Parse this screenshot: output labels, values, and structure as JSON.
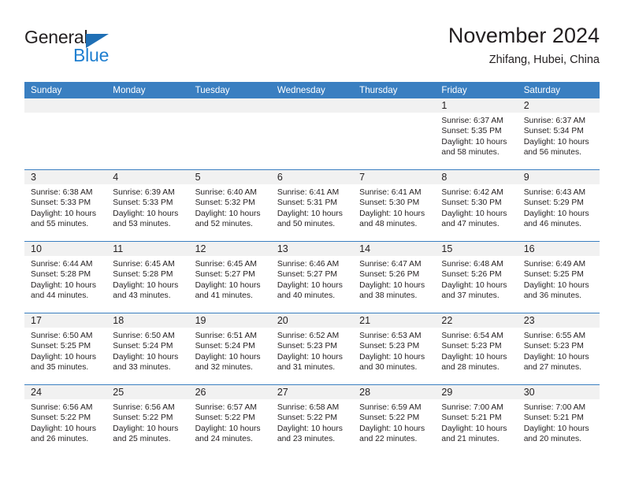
{
  "brand": {
    "name_part1": "General",
    "name_part2": "Blue",
    "triangle_color": "#1f6fb5",
    "blue_text_color": "#1f7fd0"
  },
  "header": {
    "title": "November 2024",
    "subtitle": "Zhifang, Hubei, China"
  },
  "theme": {
    "header_blue": "#3a7fc1",
    "day_band_gray": "#f1f1f1",
    "text_color": "#231f20"
  },
  "weekdays": [
    "Sunday",
    "Monday",
    "Tuesday",
    "Wednesday",
    "Thursday",
    "Friday",
    "Saturday"
  ],
  "weeks": [
    [
      {
        "day": "",
        "sunrise": "",
        "sunset": "",
        "daylight_line1": "",
        "daylight_line2": ""
      },
      {
        "day": "",
        "sunrise": "",
        "sunset": "",
        "daylight_line1": "",
        "daylight_line2": ""
      },
      {
        "day": "",
        "sunrise": "",
        "sunset": "",
        "daylight_line1": "",
        "daylight_line2": ""
      },
      {
        "day": "",
        "sunrise": "",
        "sunset": "",
        "daylight_line1": "",
        "daylight_line2": ""
      },
      {
        "day": "",
        "sunrise": "",
        "sunset": "",
        "daylight_line1": "",
        "daylight_line2": ""
      },
      {
        "day": "1",
        "sunrise": "Sunrise: 6:37 AM",
        "sunset": "Sunset: 5:35 PM",
        "daylight_line1": "Daylight: 10 hours",
        "daylight_line2": "and 58 minutes."
      },
      {
        "day": "2",
        "sunrise": "Sunrise: 6:37 AM",
        "sunset": "Sunset: 5:34 PM",
        "daylight_line1": "Daylight: 10 hours",
        "daylight_line2": "and 56 minutes."
      }
    ],
    [
      {
        "day": "3",
        "sunrise": "Sunrise: 6:38 AM",
        "sunset": "Sunset: 5:33 PM",
        "daylight_line1": "Daylight: 10 hours",
        "daylight_line2": "and 55 minutes."
      },
      {
        "day": "4",
        "sunrise": "Sunrise: 6:39 AM",
        "sunset": "Sunset: 5:33 PM",
        "daylight_line1": "Daylight: 10 hours",
        "daylight_line2": "and 53 minutes."
      },
      {
        "day": "5",
        "sunrise": "Sunrise: 6:40 AM",
        "sunset": "Sunset: 5:32 PM",
        "daylight_line1": "Daylight: 10 hours",
        "daylight_line2": "and 52 minutes."
      },
      {
        "day": "6",
        "sunrise": "Sunrise: 6:41 AM",
        "sunset": "Sunset: 5:31 PM",
        "daylight_line1": "Daylight: 10 hours",
        "daylight_line2": "and 50 minutes."
      },
      {
        "day": "7",
        "sunrise": "Sunrise: 6:41 AM",
        "sunset": "Sunset: 5:30 PM",
        "daylight_line1": "Daylight: 10 hours",
        "daylight_line2": "and 48 minutes."
      },
      {
        "day": "8",
        "sunrise": "Sunrise: 6:42 AM",
        "sunset": "Sunset: 5:30 PM",
        "daylight_line1": "Daylight: 10 hours",
        "daylight_line2": "and 47 minutes."
      },
      {
        "day": "9",
        "sunrise": "Sunrise: 6:43 AM",
        "sunset": "Sunset: 5:29 PM",
        "daylight_line1": "Daylight: 10 hours",
        "daylight_line2": "and 46 minutes."
      }
    ],
    [
      {
        "day": "10",
        "sunrise": "Sunrise: 6:44 AM",
        "sunset": "Sunset: 5:28 PM",
        "daylight_line1": "Daylight: 10 hours",
        "daylight_line2": "and 44 minutes."
      },
      {
        "day": "11",
        "sunrise": "Sunrise: 6:45 AM",
        "sunset": "Sunset: 5:28 PM",
        "daylight_line1": "Daylight: 10 hours",
        "daylight_line2": "and 43 minutes."
      },
      {
        "day": "12",
        "sunrise": "Sunrise: 6:45 AM",
        "sunset": "Sunset: 5:27 PM",
        "daylight_line1": "Daylight: 10 hours",
        "daylight_line2": "and 41 minutes."
      },
      {
        "day": "13",
        "sunrise": "Sunrise: 6:46 AM",
        "sunset": "Sunset: 5:27 PM",
        "daylight_line1": "Daylight: 10 hours",
        "daylight_line2": "and 40 minutes."
      },
      {
        "day": "14",
        "sunrise": "Sunrise: 6:47 AM",
        "sunset": "Sunset: 5:26 PM",
        "daylight_line1": "Daylight: 10 hours",
        "daylight_line2": "and 38 minutes."
      },
      {
        "day": "15",
        "sunrise": "Sunrise: 6:48 AM",
        "sunset": "Sunset: 5:26 PM",
        "daylight_line1": "Daylight: 10 hours",
        "daylight_line2": "and 37 minutes."
      },
      {
        "day": "16",
        "sunrise": "Sunrise: 6:49 AM",
        "sunset": "Sunset: 5:25 PM",
        "daylight_line1": "Daylight: 10 hours",
        "daylight_line2": "and 36 minutes."
      }
    ],
    [
      {
        "day": "17",
        "sunrise": "Sunrise: 6:50 AM",
        "sunset": "Sunset: 5:25 PM",
        "daylight_line1": "Daylight: 10 hours",
        "daylight_line2": "and 35 minutes."
      },
      {
        "day": "18",
        "sunrise": "Sunrise: 6:50 AM",
        "sunset": "Sunset: 5:24 PM",
        "daylight_line1": "Daylight: 10 hours",
        "daylight_line2": "and 33 minutes."
      },
      {
        "day": "19",
        "sunrise": "Sunrise: 6:51 AM",
        "sunset": "Sunset: 5:24 PM",
        "daylight_line1": "Daylight: 10 hours",
        "daylight_line2": "and 32 minutes."
      },
      {
        "day": "20",
        "sunrise": "Sunrise: 6:52 AM",
        "sunset": "Sunset: 5:23 PM",
        "daylight_line1": "Daylight: 10 hours",
        "daylight_line2": "and 31 minutes."
      },
      {
        "day": "21",
        "sunrise": "Sunrise: 6:53 AM",
        "sunset": "Sunset: 5:23 PM",
        "daylight_line1": "Daylight: 10 hours",
        "daylight_line2": "and 30 minutes."
      },
      {
        "day": "22",
        "sunrise": "Sunrise: 6:54 AM",
        "sunset": "Sunset: 5:23 PM",
        "daylight_line1": "Daylight: 10 hours",
        "daylight_line2": "and 28 minutes."
      },
      {
        "day": "23",
        "sunrise": "Sunrise: 6:55 AM",
        "sunset": "Sunset: 5:23 PM",
        "daylight_line1": "Daylight: 10 hours",
        "daylight_line2": "and 27 minutes."
      }
    ],
    [
      {
        "day": "24",
        "sunrise": "Sunrise: 6:56 AM",
        "sunset": "Sunset: 5:22 PM",
        "daylight_line1": "Daylight: 10 hours",
        "daylight_line2": "and 26 minutes."
      },
      {
        "day": "25",
        "sunrise": "Sunrise: 6:56 AM",
        "sunset": "Sunset: 5:22 PM",
        "daylight_line1": "Daylight: 10 hours",
        "daylight_line2": "and 25 minutes."
      },
      {
        "day": "26",
        "sunrise": "Sunrise: 6:57 AM",
        "sunset": "Sunset: 5:22 PM",
        "daylight_line1": "Daylight: 10 hours",
        "daylight_line2": "and 24 minutes."
      },
      {
        "day": "27",
        "sunrise": "Sunrise: 6:58 AM",
        "sunset": "Sunset: 5:22 PM",
        "daylight_line1": "Daylight: 10 hours",
        "daylight_line2": "and 23 minutes."
      },
      {
        "day": "28",
        "sunrise": "Sunrise: 6:59 AM",
        "sunset": "Sunset: 5:22 PM",
        "daylight_line1": "Daylight: 10 hours",
        "daylight_line2": "and 22 minutes."
      },
      {
        "day": "29",
        "sunrise": "Sunrise: 7:00 AM",
        "sunset": "Sunset: 5:21 PM",
        "daylight_line1": "Daylight: 10 hours",
        "daylight_line2": "and 21 minutes."
      },
      {
        "day": "30",
        "sunrise": "Sunrise: 7:00 AM",
        "sunset": "Sunset: 5:21 PM",
        "daylight_line1": "Daylight: 10 hours",
        "daylight_line2": "and 20 minutes."
      }
    ]
  ]
}
